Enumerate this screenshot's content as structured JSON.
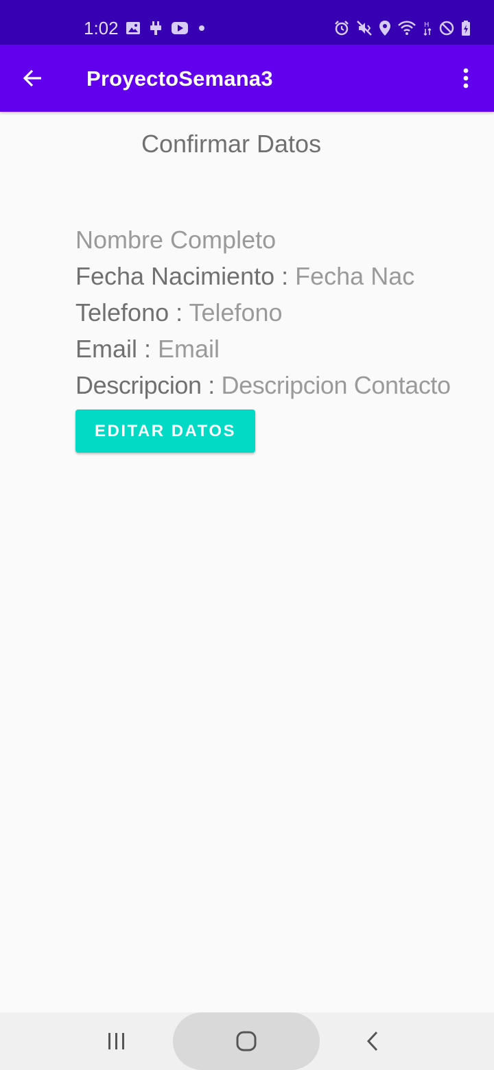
{
  "status_bar": {
    "time": "1:02",
    "left_icons": [
      "image-icon",
      "usb-icon",
      "youtube-icon",
      "dot-icon"
    ],
    "right_icons": [
      "alarm-icon",
      "vibrate-icon",
      "location-icon",
      "wifi-icon",
      "network-h-icon",
      "do-not-disturb-icon",
      "battery-icon"
    ],
    "network_label": "H"
  },
  "app_bar": {
    "title": "ProyectoSemana3",
    "back_icon": "arrow-back-icon",
    "menu_icon": "more-vert-icon",
    "background": "#6200ee"
  },
  "content": {
    "heading": "Confirmar Datos",
    "name_value": "Nombre Completo",
    "birth_label": "Fecha Nacimiento : ",
    "birth_value": "Fecha Nac",
    "phone_label": "Telefono : ",
    "phone_value": "Telefono",
    "email_label": "Email : ",
    "email_value": "Email",
    "description_label": "Descripcion : ",
    "description_value": "Descripcion Contacto",
    "edit_button_label": "EDITAR DATOS",
    "accent_color": "#03dac5"
  },
  "nav_bar": {
    "recents_icon": "recent-apps-icon",
    "home_icon": "home-icon",
    "back_icon": "back-chevron-icon"
  }
}
